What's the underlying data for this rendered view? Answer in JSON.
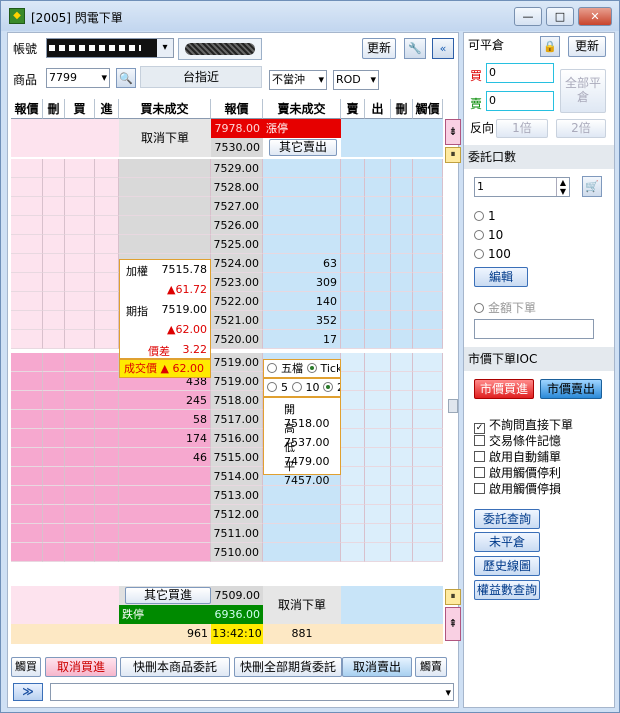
{
  "window": {
    "title": "[2005] 閃電下單",
    "min": "—",
    "max": "□",
    "close": "✕"
  },
  "top": {
    "account_label": "帳號",
    "product_label": "商品",
    "product_code": "7799",
    "product_name": "台指近",
    "position_mode": "不當沖",
    "order_type": "ROD",
    "refresh": "更新"
  },
  "headers": [
    "報價",
    "刪",
    "買",
    "進",
    "買未成交",
    "報價",
    "賣未成交",
    "賣",
    "出",
    "刪",
    "觸價"
  ],
  "top_block": {
    "cancel_buy": "取消下單",
    "limit_up_price": "7978.00",
    "limit_up_label": "漲停",
    "top_price": "7530.00",
    "other_sell": "其它賣出"
  },
  "info_box": {
    "weighted_label": "加權",
    "weighted_value": "7515.78",
    "weighted_change": "▲61.72",
    "futures_label": "期指",
    "futures_value": "7519.00",
    "futures_change": "▲62.00",
    "spread_label": "價差",
    "spread_value": "3.22",
    "last_label": "成交價",
    "last_value": "▲ 62.00"
  },
  "radio_row1": [
    "五檔",
    "Tick"
  ],
  "radio_row2": [
    "5",
    "10",
    "20"
  ],
  "stats": {
    "open": "開 7518.00",
    "high": "高 7537.00",
    "low": "低 7479.00",
    "flat": "平 7457.00"
  },
  "ladder": [
    {
      "price": "7529.00",
      "sell": "",
      "buy": ""
    },
    {
      "price": "7528.00",
      "sell": "",
      "buy": ""
    },
    {
      "price": "7527.00",
      "sell": "",
      "buy": ""
    },
    {
      "price": "7526.00",
      "sell": "",
      "buy": ""
    },
    {
      "price": "7525.00",
      "sell": "",
      "buy": ""
    },
    {
      "price": "7524.00",
      "sell": "63",
      "buy": ""
    },
    {
      "price": "7523.00",
      "sell": "309",
      "buy": ""
    },
    {
      "price": "7522.00",
      "sell": "140",
      "buy": ""
    },
    {
      "price": "7521.00",
      "sell": "352",
      "buy": ""
    },
    {
      "price": "7520.00",
      "sell": "17",
      "buy": ""
    },
    {
      "price": "7519.00",
      "sell": "",
      "buy": ""
    },
    {
      "price": "7519.00",
      "sell": "",
      "buy": "438"
    },
    {
      "price": "7518.00",
      "sell": "",
      "buy": "245"
    },
    {
      "price": "7517.00",
      "sell": "",
      "buy": "58"
    },
    {
      "price": "7516.00",
      "sell": "",
      "buy": "174"
    },
    {
      "price": "7515.00",
      "sell": "",
      "buy": "46"
    },
    {
      "price": "7514.00",
      "sell": "",
      "buy": ""
    },
    {
      "price": "7513.00",
      "sell": "",
      "buy": ""
    },
    {
      "price": "7512.00",
      "sell": "",
      "buy": ""
    },
    {
      "price": "7511.00",
      "sell": "",
      "buy": ""
    },
    {
      "price": "7510.00",
      "sell": "",
      "buy": ""
    }
  ],
  "bottom_block": {
    "other_buy": "其它買進",
    "bottom_price": "7509.00",
    "limit_down_label": "跌停",
    "limit_down_price": "6936.00",
    "cancel_sell": "取消下單",
    "buy_total": "961",
    "time": "13:42:10",
    "sell_total": "881"
  },
  "bottom_bar": {
    "touch_buy": "觸買",
    "cancel_buy": "取消買進",
    "quick_cancel_product": "快刪本商品委託",
    "quick_cancel_all": "快刪全部期貨委託",
    "cancel_sell": "取消賣出",
    "touch_sell": "觸賣"
  },
  "right": {
    "closable_label": "可平倉",
    "refresh": "更新",
    "buy_label": "買",
    "sell_label": "賣",
    "buy_qty": "0",
    "sell_qty": "0",
    "close_all": "全部平倉",
    "reverse_label": "反向",
    "times1": "1倍",
    "times2": "2倍",
    "order_qty_label": "委託口數",
    "qty_value": "1",
    "radio_opts": [
      "1",
      "10",
      "100"
    ],
    "edit": "編輯",
    "amount_order": "金額下單",
    "ioc_label": "市價下單IOC",
    "market_buy": "市價買進",
    "market_sell": "市價賣出",
    "checks": [
      "不詢問直接下單",
      "交易條件記憶",
      "啟用自動鋪單",
      "啟用觸價停利",
      "啟用觸價停損"
    ],
    "btn_orders": "委託查詢",
    "btn_unclosed": "未平倉",
    "btn_history": "歷史線圖",
    "btn_pnl": "權益數查詢"
  }
}
